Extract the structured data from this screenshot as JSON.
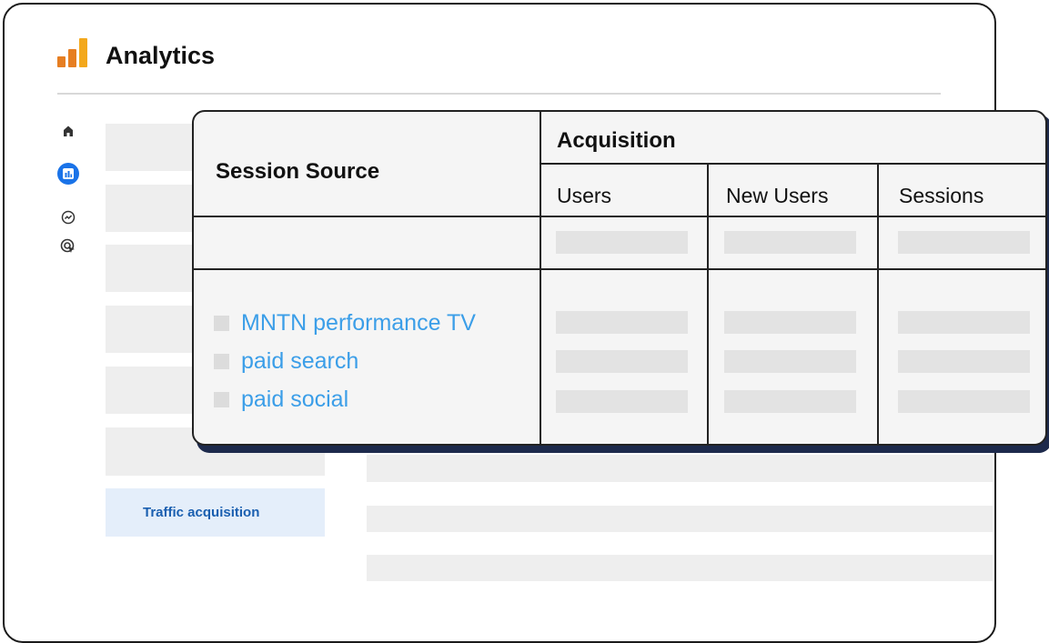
{
  "app": {
    "title": "Analytics"
  },
  "colors": {
    "accent": "#1a73e8",
    "logo": [
      "#e8a33a",
      "#e87a1a",
      "#f0a21f"
    ],
    "link": "#3b9ee8"
  },
  "nav": [
    {
      "icon": "home-icon"
    },
    {
      "icon": "bar-chart-icon",
      "active": true
    },
    {
      "icon": "trend-icon"
    },
    {
      "icon": "target-cursor-icon"
    }
  ],
  "sidebar": {
    "active_item": "Traffic acquisition"
  },
  "table": {
    "dimension_header": "Session Source",
    "group_header": "Acquisition",
    "columns": [
      "Users",
      "New Users",
      "Sessions"
    ],
    "rows": [
      {
        "label": "MNTN performance TV"
      },
      {
        "label": "paid search"
      },
      {
        "label": "paid social"
      }
    ]
  }
}
